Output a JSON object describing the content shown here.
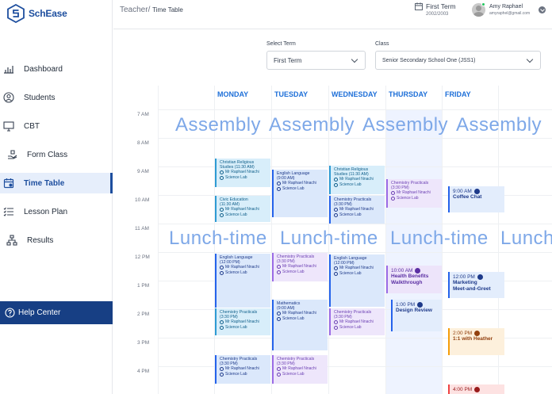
{
  "app": {
    "name": "SchEase"
  },
  "sidebar": {
    "items": [
      {
        "label": "Dashboard",
        "icon": "bar-chart-icon"
      },
      {
        "label": "Students",
        "icon": "user-circle-icon"
      },
      {
        "label": "CBT",
        "icon": "monitor-icon"
      },
      {
        "label": "Form Class",
        "icon": "hand-icon"
      },
      {
        "label": "Time Table",
        "icon": "calendar-icon",
        "active": true
      },
      {
        "label": "Lesson Plan",
        "icon": "list-icon"
      },
      {
        "label": "Results",
        "icon": "network-icon"
      }
    ],
    "help": "Help Center"
  },
  "header": {
    "breadcrumb_parent": "Teacher/",
    "breadcrumb_current": "Time Table",
    "term_name": "First Term",
    "term_year": "2002/2003",
    "user_name": "Amy Raphael",
    "user_email": "amyraphel@gmail.com"
  },
  "filters": {
    "term_label": "Select Term",
    "term_value": "First Term",
    "class_label": "Class",
    "class_value": "Senior Secondary School One (JSS1)"
  },
  "calendar": {
    "days": [
      "MONDAY",
      "TUESDAY",
      "WEDNESDAY",
      "THURSDAY",
      "FRIDAY"
    ],
    "times": [
      "7 AM",
      "8 AM",
      "9 AM",
      "10 AM",
      "11 AM",
      "12 PM",
      "1 PM",
      "2 PM",
      "3 PM",
      "4 PM"
    ],
    "assembly": "Assembly",
    "lunch": "Lunch-time",
    "events": [
      {
        "title": "Christian Religious\nStudies (11:30 AM)",
        "teacher": "Mr Raphael Nnachi",
        "room": "Science Lab"
      },
      {
        "title": "Civic Education\n(11:30 AM)",
        "teacher": "Mr Raphael Nnachi",
        "room": "Science Lab"
      },
      {
        "title": "English Language\n(12:00 PM)",
        "teacher": "Mr Raphael Nnachi",
        "room": "Science Lab"
      },
      {
        "title": "Chemistry Practicals\n(3:30 PM)",
        "teacher": "Mr Raphael Nnachi",
        "room": "Science Lab"
      },
      {
        "title": "Chemistry Practicals\n(3:30 PM)",
        "teacher": "Mr Raphael Nnachi",
        "room": "Science Lab"
      },
      {
        "title": "English Language\n(9:00 AM)",
        "teacher": "Mr Raphael Nnachi",
        "room": "Science Lab"
      },
      {
        "title": "Chemistry Practicals\n(3:30 PM)",
        "teacher": "Mr Raphael Nnachi",
        "room": "Science Lab"
      },
      {
        "title": "Mathematics\n(9:00 AM)",
        "teacher": "Mr Raphael Nnachi",
        "room": "Science Lab"
      },
      {
        "title": "Chemistry Practicals\n(3:30 PM)",
        "teacher": "Mr Raphael Nnachi",
        "room": "Science Lab"
      },
      {
        "title": "Christian Religious\nStudies (11:30 AM)",
        "teacher": "Mr Raphael Nnachi",
        "room": "Science Lab"
      },
      {
        "title": "Chemistry Practicals\n(3:30 PM)",
        "teacher": "Mr Raphael Nnachi",
        "room": "Science Lab"
      },
      {
        "title": "English Language\n(12:00 PM)",
        "teacher": "Mr Raphael Nnachi",
        "room": "Science Lab"
      },
      {
        "title": "Chemistry Practicals\n(3:30 PM)",
        "teacher": "Mr Raphael Nnachi",
        "room": "Science Lab"
      },
      {
        "title": "Chemistry Practicals\n(3:30 PM)",
        "teacher": "Mr Raphael Nnachi",
        "room": "Science Lab"
      }
    ],
    "pills": [
      {
        "time": "10:00 AM",
        "name": "Health Benefits\nWalkthrough"
      },
      {
        "time": "1:00 PM",
        "name": "Design Review"
      },
      {
        "time": "9:00 AM",
        "name": "Coffee Chat"
      },
      {
        "time": "12:00 PM",
        "name": "Marketing\nMeet-and-Greet"
      },
      {
        "time": "2:00 PM",
        "name": "1:1 with Heather"
      },
      {
        "time": "4:00 PM",
        "name": ""
      }
    ]
  },
  "colors": {
    "brand": "#1d4e9e",
    "accent": "#1d6fd8",
    "help_bg": "#173f84"
  }
}
